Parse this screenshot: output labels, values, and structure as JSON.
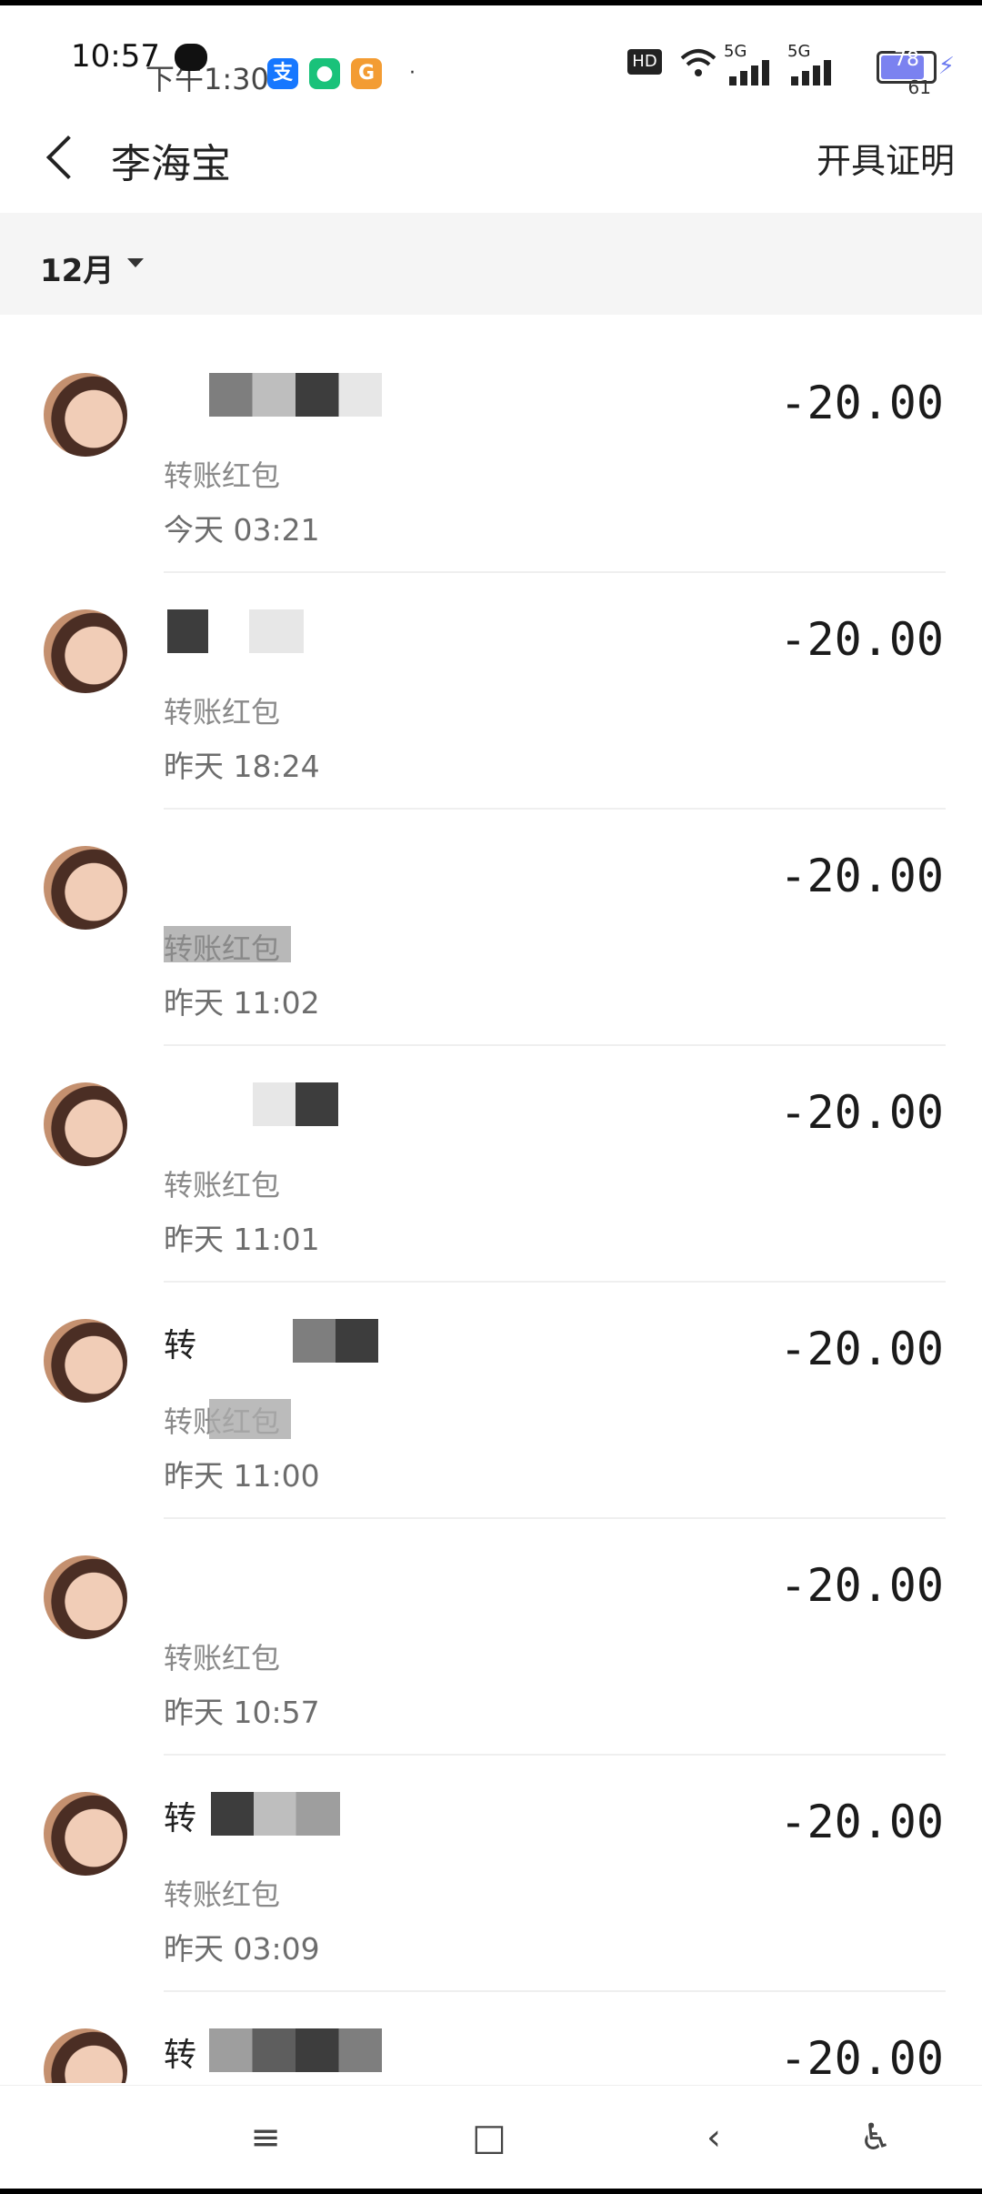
{
  "status_bar": {
    "time": "10:57",
    "time2": "下午1:30",
    "battery_level": "78",
    "battery_level_2": "61",
    "network_labels": [
      "HD",
      "5G",
      "5G"
    ],
    "apps": [
      {
        "name": "alipay-icon",
        "glyph": "支",
        "color": "#1677ff"
      },
      {
        "name": "shield-app-icon",
        "glyph": "●",
        "color": "#19c27a"
      },
      {
        "name": "orange-app-icon",
        "glyph": "G",
        "color": "#f39c33"
      }
    ],
    "dot": "·"
  },
  "header": {
    "title": "李海宝",
    "right_action": "开具证明"
  },
  "filter": {
    "month": "12月"
  },
  "transactions": [
    {
      "name": "",
      "kind": "转账红包",
      "time": "今天  03:21",
      "amount": "-20.00"
    },
    {
      "name": "",
      "kind": "转账红包",
      "time": "昨天  18:24",
      "amount": "-20.00"
    },
    {
      "name": "",
      "kind": "转账红包",
      "time": "昨天  11:02",
      "amount": "-20.00"
    },
    {
      "name": "",
      "kind": "转账红包",
      "time": "昨天  11:01",
      "amount": "-20.00"
    },
    {
      "name": "转",
      "kind": "转账红包",
      "time": "昨天  11:00",
      "amount": "-20.00"
    },
    {
      "name": "",
      "kind": "转账红包",
      "time": "昨天  10:57",
      "amount": "-20.00"
    },
    {
      "name": "转",
      "kind": "转账红包",
      "time": "昨天  03:09",
      "amount": "-20.00"
    },
    {
      "name": "转",
      "kind": "",
      "time": "",
      "amount": "-20.00"
    }
  ],
  "nav": {
    "menu": "≡",
    "home": "□",
    "back": "‹",
    "accessibility": "♿"
  }
}
